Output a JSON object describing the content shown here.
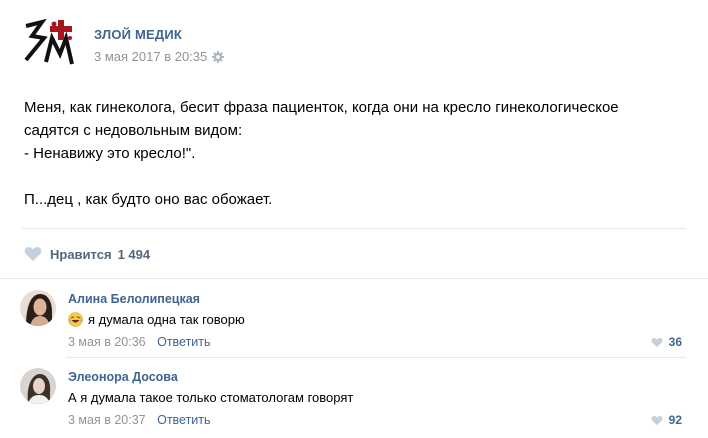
{
  "post": {
    "author": "ЗЛОЙ МЕДИК",
    "date": "3 мая 2017 в 20:35",
    "text_lines": [
      "Меня, как гинеколога, бесит фраза пациенток, когда они на кресло гинекологическое",
      "садятся с недовольным видом:",
      "- Ненавижу это кресло!\".",
      "П...дец , как будто оно вас обожает."
    ],
    "likes_label": "Нравится",
    "likes_count": "1 494"
  },
  "comments": [
    {
      "name": "Алина Белолипецкая",
      "text": "я думала одна так говорю",
      "date": "3 мая в 20:36",
      "reply_label": "Ответить",
      "likes": "36",
      "has_emoji": true
    },
    {
      "name": "Элеонора Досова",
      "text": "А я думала такое только стоматологам говорят",
      "date": "3 мая в 20:37",
      "reply_label": "Ответить",
      "likes": "92",
      "has_emoji": false
    }
  ],
  "colors": {
    "link": "#3f6591",
    "muted": "#939393",
    "heart": "#c5d0db",
    "logo_red": "#a8151f"
  },
  "icons": [
    "community-logo",
    "gear-icon",
    "heart-icon",
    "laughing-emoji-icon"
  ]
}
